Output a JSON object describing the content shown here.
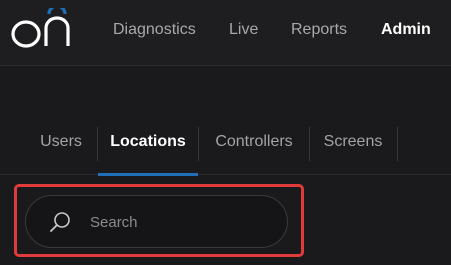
{
  "brand": {
    "logo_text": "on",
    "accent": "#1f6fb8"
  },
  "nav": {
    "items": [
      {
        "label": "Diagnostics"
      },
      {
        "label": "Live"
      },
      {
        "label": "Reports"
      },
      {
        "label": "Admin",
        "active": true
      }
    ]
  },
  "tabs": {
    "items": [
      {
        "label": "Users"
      },
      {
        "label": "Locations",
        "active": true
      },
      {
        "label": "Controllers"
      },
      {
        "label": "Screens"
      }
    ]
  },
  "search": {
    "placeholder": "Search",
    "value": "",
    "icon": "search-icon"
  },
  "colors": {
    "highlight": "#e03a3a",
    "background": "#1a1a1c"
  }
}
